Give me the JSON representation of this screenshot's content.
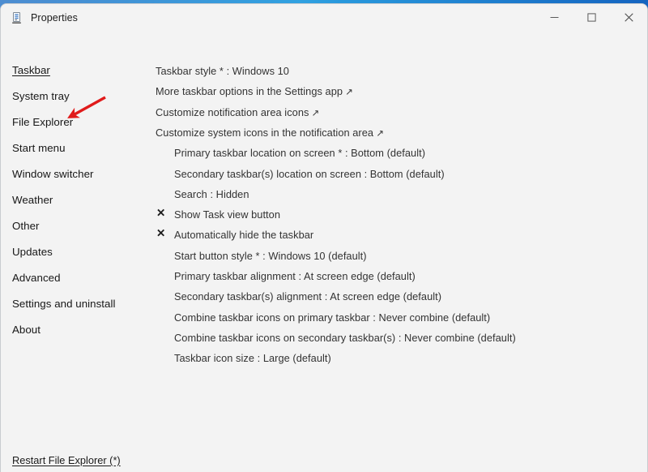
{
  "window": {
    "title": "Properties",
    "icon": "properties-document-icon",
    "controls": [
      {
        "name": "minimize",
        "glyph": "minimize-icon"
      },
      {
        "name": "maximize",
        "glyph": "maximize-icon"
      },
      {
        "name": "close",
        "glyph": "close-icon"
      }
    ]
  },
  "sidebar": {
    "items": [
      {
        "label": "Taskbar",
        "key": "taskbar",
        "selected": true
      },
      {
        "label": "System tray",
        "key": "system-tray",
        "selected": false
      },
      {
        "label": "File Explorer",
        "key": "file-explorer",
        "selected": false
      },
      {
        "label": "Start menu",
        "key": "start-menu",
        "selected": false
      },
      {
        "label": "Window switcher",
        "key": "window-switcher",
        "selected": false
      },
      {
        "label": "Weather",
        "key": "weather",
        "selected": false
      },
      {
        "label": "Other",
        "key": "other",
        "selected": false
      },
      {
        "label": "Updates",
        "key": "updates",
        "selected": false
      },
      {
        "label": "Advanced",
        "key": "advanced",
        "selected": false
      },
      {
        "label": "Settings and uninstall",
        "key": "settings-and-uninstall",
        "selected": false
      },
      {
        "label": "About",
        "key": "about",
        "selected": false
      }
    ]
  },
  "annotation": {
    "type": "red-arrow",
    "color": "#e01b1b",
    "points_at": "File Explorer"
  },
  "options": [
    {
      "label": "Taskbar style * : Windows 10",
      "indent": 0,
      "mark": "",
      "external": false
    },
    {
      "label": "More taskbar options in the Settings app",
      "indent": 0,
      "mark": "",
      "external": true
    },
    {
      "label": "Customize notification area icons",
      "indent": 0,
      "mark": "",
      "external": true
    },
    {
      "label": "Customize system icons in the notification area",
      "indent": 0,
      "mark": "",
      "external": true
    },
    {
      "label": "Primary taskbar location on screen * : Bottom (default)",
      "indent": 1,
      "mark": "",
      "external": false
    },
    {
      "label": "Secondary taskbar(s) location on screen : Bottom (default)",
      "indent": 1,
      "mark": "",
      "external": false
    },
    {
      "label": "Search : Hidden",
      "indent": 1,
      "mark": "",
      "external": false
    },
    {
      "label": "Show Task view button",
      "indent": 1,
      "mark": "✕",
      "external": false
    },
    {
      "label": "Automatically hide the taskbar",
      "indent": 1,
      "mark": "✕",
      "external": false
    },
    {
      "label": "Start button style * : Windows 10 (default)",
      "indent": 1,
      "mark": "",
      "external": false
    },
    {
      "label": "Primary taskbar alignment : At screen edge (default)",
      "indent": 1,
      "mark": "",
      "external": false
    },
    {
      "label": "Secondary taskbar(s) alignment : At screen edge (default)",
      "indent": 1,
      "mark": "",
      "external": false
    },
    {
      "label": "Combine taskbar icons on primary taskbar : Never combine (default)",
      "indent": 1,
      "mark": "",
      "external": false
    },
    {
      "label": "Combine taskbar icons on secondary taskbar(s) : Never combine (default)",
      "indent": 1,
      "mark": "",
      "external": false
    },
    {
      "label": "Taskbar icon size : Large (default)",
      "indent": 1,
      "mark": "",
      "external": false
    }
  ],
  "footer": {
    "link_label": "Restart File Explorer (*)"
  },
  "colors": {
    "window_bg": "#f3f3f3",
    "text": "#333333",
    "nav_text": "#171717",
    "annotation": "#e01b1b",
    "desktop": "#1b6fc4"
  }
}
